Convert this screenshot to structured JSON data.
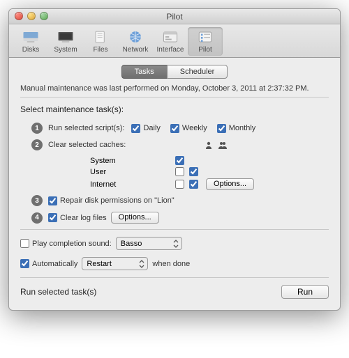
{
  "window": {
    "title": "Pilot"
  },
  "toolbar": {
    "items": [
      {
        "label": "Disks"
      },
      {
        "label": "System"
      },
      {
        "label": "Files"
      },
      {
        "label": "Network"
      },
      {
        "label": "Interface"
      },
      {
        "label": "Pilot"
      }
    ]
  },
  "tabs": {
    "tasks": "Tasks",
    "scheduler": "Scheduler"
  },
  "status": "Manual maintenance was last performed on Monday, October 3, 2011 at 2:37:32 PM.",
  "section_label": "Select maintenance task(s):",
  "step1": {
    "label": "Run selected script(s):",
    "daily": "Daily",
    "weekly": "Weekly",
    "monthly": "Monthly"
  },
  "step2": {
    "label": "Clear selected caches:",
    "rows": {
      "system": "System",
      "user": "User",
      "internet": "Internet"
    },
    "options_btn": "Options..."
  },
  "step3": {
    "label": "Repair disk permissions on \"Lion\""
  },
  "step4": {
    "label": "Clear log files",
    "options_btn": "Options..."
  },
  "sound": {
    "label": "Play completion sound:",
    "value": "Basso"
  },
  "auto": {
    "label": "Automatically",
    "value": "Restart",
    "suffix": "when done"
  },
  "run": {
    "label": "Run selected task(s)",
    "button": "Run"
  }
}
